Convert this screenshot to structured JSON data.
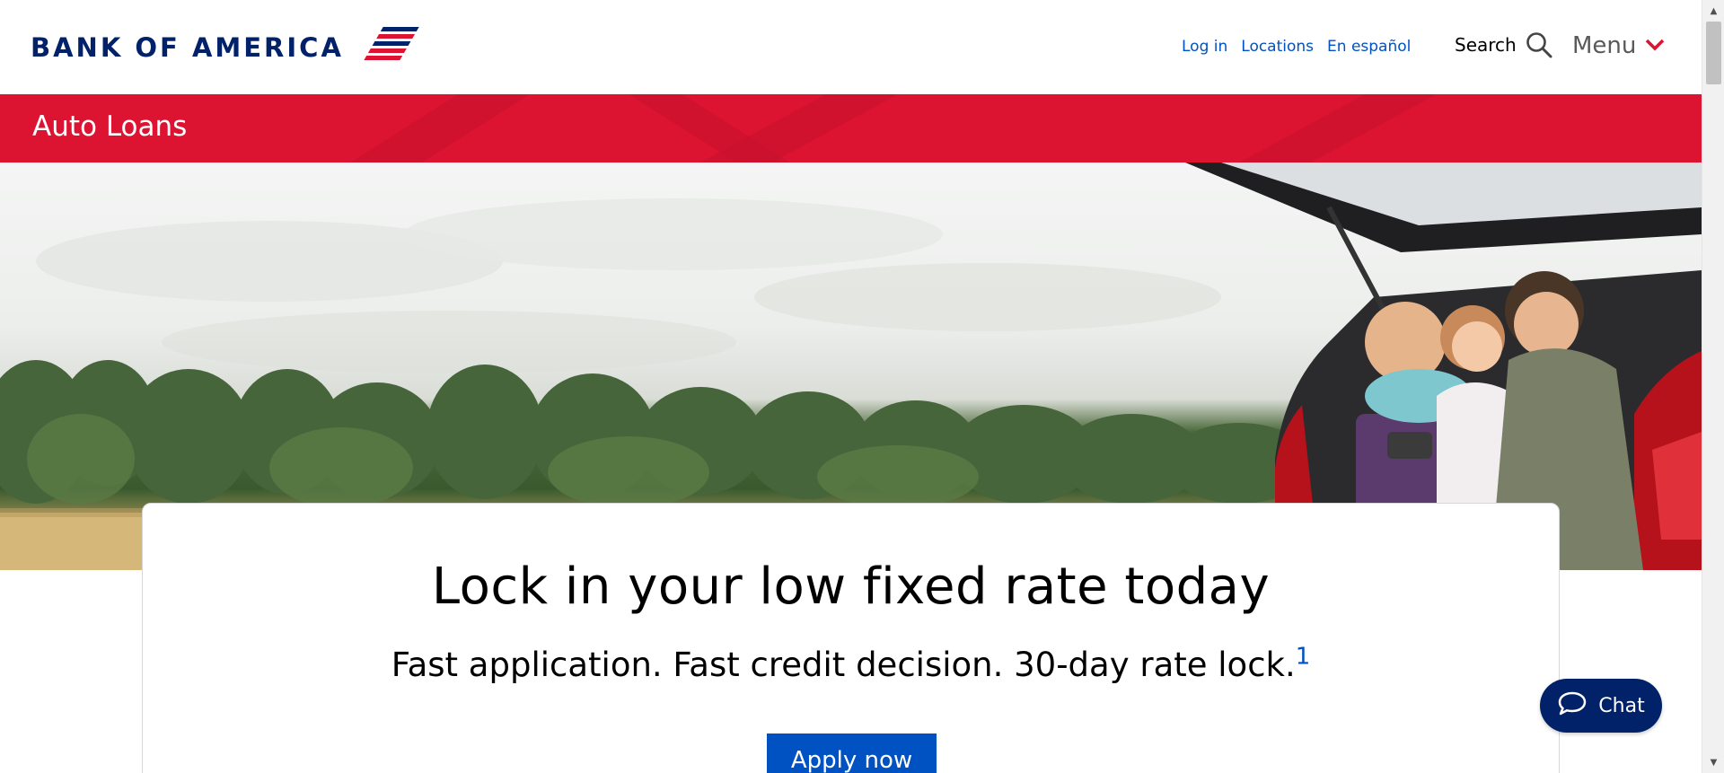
{
  "header": {
    "logo_text": "BANK OF AMERICA",
    "links": [
      {
        "label": "Log in"
      },
      {
        "label": "Locations"
      },
      {
        "label": "En español"
      }
    ],
    "search_label": "Search",
    "search_icon": "search-icon",
    "menu_label": "Menu",
    "menu_icon": "chevron-down-icon"
  },
  "banner": {
    "title": "Auto Loans"
  },
  "promo": {
    "title": "Lock in your low fixed rate today",
    "subtitle": "Fast application. Fast credit decision. 30-day rate lock.",
    "footnote": "1",
    "cta_label": "Apply now"
  },
  "chat": {
    "label": "Chat",
    "icon": "chat-bubble-icon"
  },
  "colors": {
    "brand_red": "#dc1431",
    "brand_navy": "#012169",
    "link_blue": "#0052c2"
  }
}
